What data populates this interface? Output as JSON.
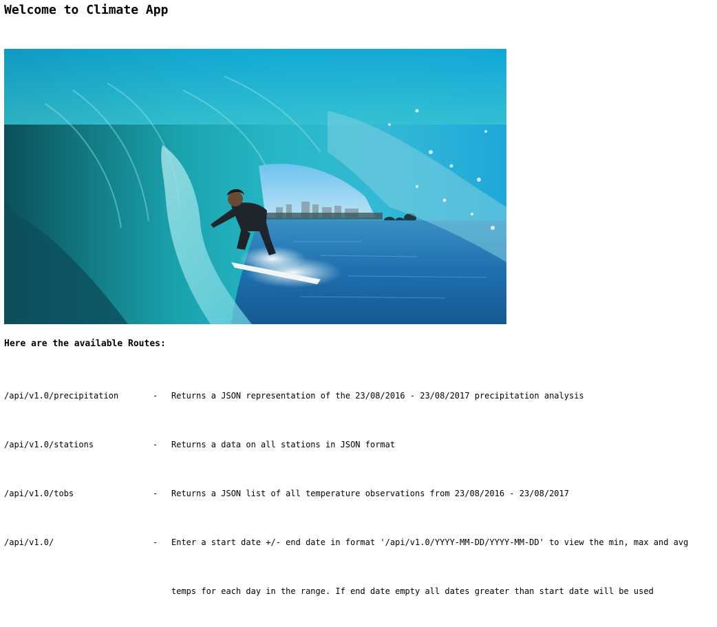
{
  "header": {
    "title": "Welcome to Climate App"
  },
  "hero_image": {
    "description_icon": "surfer-in-wave-photo"
  },
  "routes": {
    "heading": "Here are the available Routes:",
    "items": [
      {
        "path": "/api/v1.0/precipitation",
        "separator": "-",
        "description": "Returns a JSON representation of the 23/08/2016 - 23/08/2017 precipitation analysis"
      },
      {
        "path": "/api/v1.0/stations",
        "separator": "-",
        "description": "Returns a data on all stations in JSON format"
      },
      {
        "path": "/api/v1.0/tobs",
        "separator": "-",
        "description": "Returns a JSON list of all temperature observations from 23/08/2016 - 23/08/2017"
      },
      {
        "path": "/api/v1.0/",
        "separator": "-",
        "description": "Enter a start date +/- end date in format '/api/v1.0/YYYY-MM-DD/YYYY-MM-DD' to view the min, max and avg"
      }
    ],
    "continuation": "temps for each day in the range. If end date empty all dates greater than start date will be used"
  }
}
